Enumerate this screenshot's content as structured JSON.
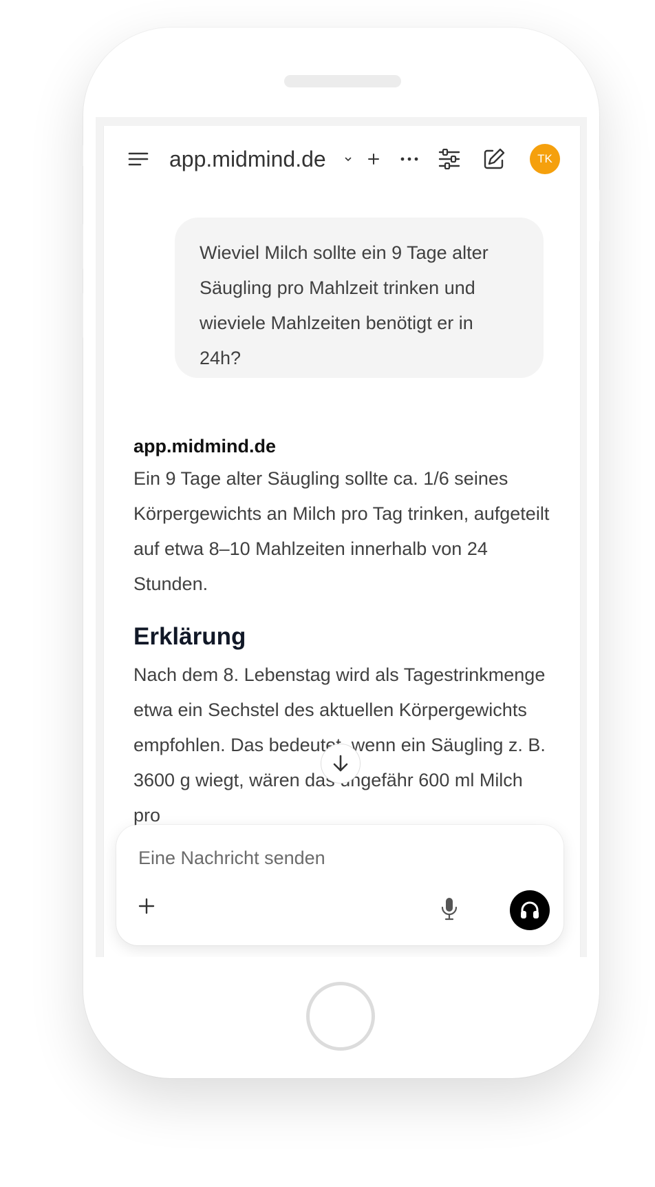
{
  "header": {
    "site_title": "app.midmind.de",
    "avatar_initials": "TK"
  },
  "conversation": {
    "user_message": "Wieviel Milch sollte ein 9 Tage alter Säugling pro Mahlzeit trinken und wieviele Mahlzeiten benötigt er in 24h?",
    "assistant_name": "app.midmind.de",
    "answer": "Ein 9 Tage alter Säugling sollte ca. 1/6 seines Körpergewichts an Milch pro Tag trinken, aufgeteilt auf etwa 8–10 Mahlzeiten innerhalb von 24 Stunden.",
    "heading": "Erklärung",
    "explanation": "Nach dem 8. Lebenstag wird als Tagestrinkmenge etwa ein Sechstel des aktuellen Körpergewichts empfohlen. Das bedeutet, wenn ein Säugling z. B. 3600 g wiegt, wären das ungefähr 600 ml Milch pro"
  },
  "composer": {
    "placeholder": "Eine Nachricht senden"
  },
  "colors": {
    "avatar": "#f5a00d",
    "send_button": "#000000",
    "bubble": "#f4f4f4"
  },
  "icons": [
    "menu-icon",
    "chevron-down-icon",
    "plus-icon",
    "more-icon",
    "sliders-icon",
    "edit-icon",
    "arrow-down-icon",
    "mic-icon",
    "headphones-icon"
  ]
}
